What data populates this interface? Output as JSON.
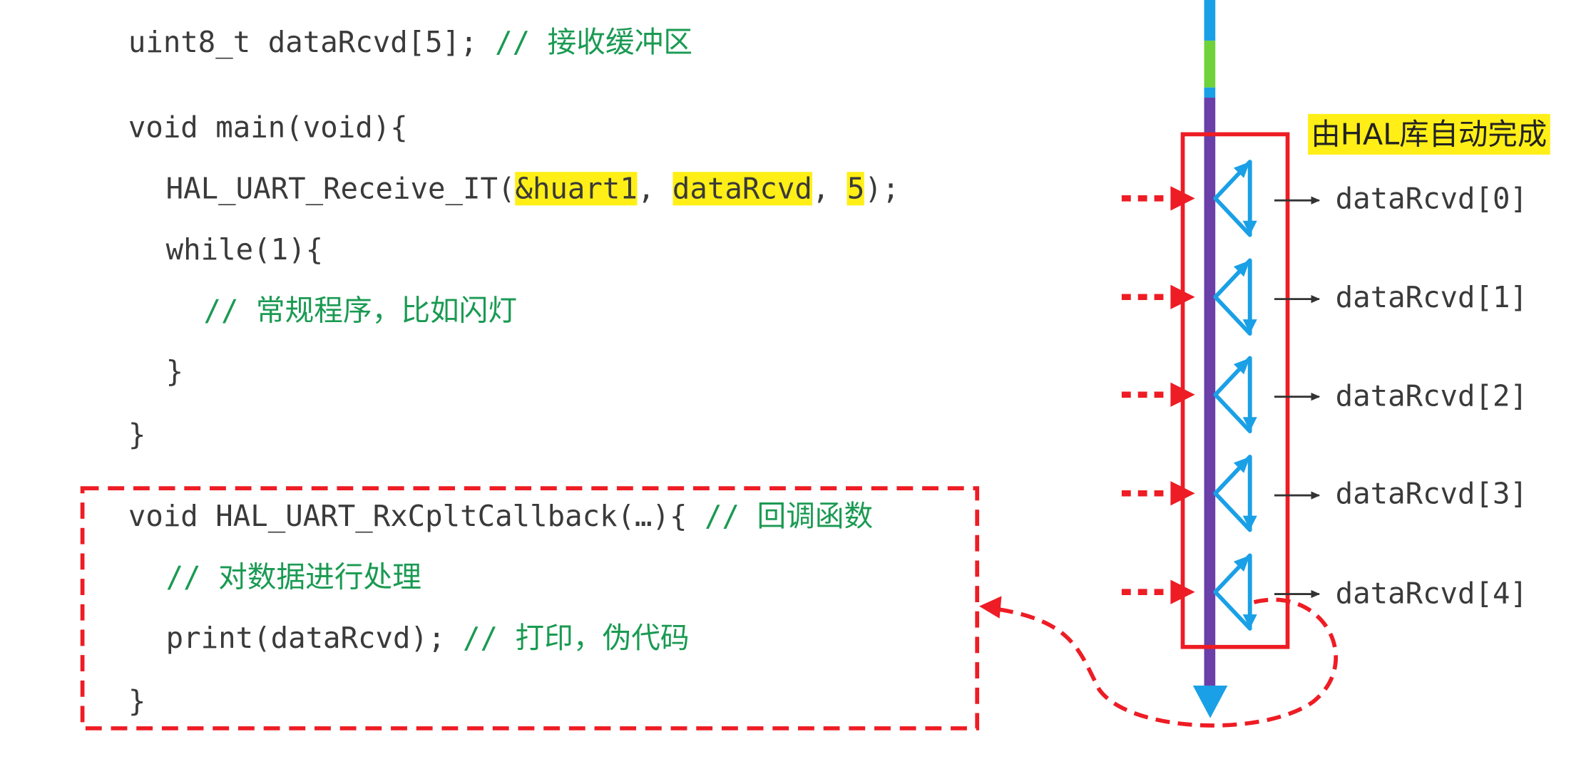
{
  "code": {
    "decl_code": "uint8_t dataRcvd[5];",
    "decl_comment": "// 接收缓冲区",
    "main_sig": "void main(void){",
    "call_prefix": "HAL_UART_Receive_IT(",
    "arg1": "&huart1",
    "sep1": ", ",
    "arg2": "dataRcvd",
    "sep2": ", ",
    "arg3": "5",
    "call_suffix": ");",
    "while_line": "while(1){",
    "loop_comment": "// 常规程序，比如闪灯",
    "close_inner": "}",
    "close_outer": "}",
    "cb_sig": "void HAL_UART_RxCpltCallback(…){",
    "cb_comment": "// 回调函数",
    "process_comment": "// 对数据进行处理",
    "print_code": "print(dataRcvd);",
    "print_comment": "// 打印，伪代码",
    "close_cb": "}"
  },
  "timeline": {
    "note": "由HAL库自动完成",
    "buffer_labels": [
      "dataRcvd[0]",
      "dataRcvd[1]",
      "dataRcvd[2]",
      "dataRcvd[3]",
      "dataRcvd[4]"
    ]
  },
  "colors": {
    "timeline_main": "#6a3fa8",
    "timeline_top": "#1aa0e6",
    "timeline_green": "#6fd23a",
    "interrupt_arrow": "#ee1c24",
    "frame_red": "#ee1c24",
    "handler_blue": "#1aa0e6",
    "comment_green": "#1a9a52",
    "highlight": "#ffef16"
  }
}
